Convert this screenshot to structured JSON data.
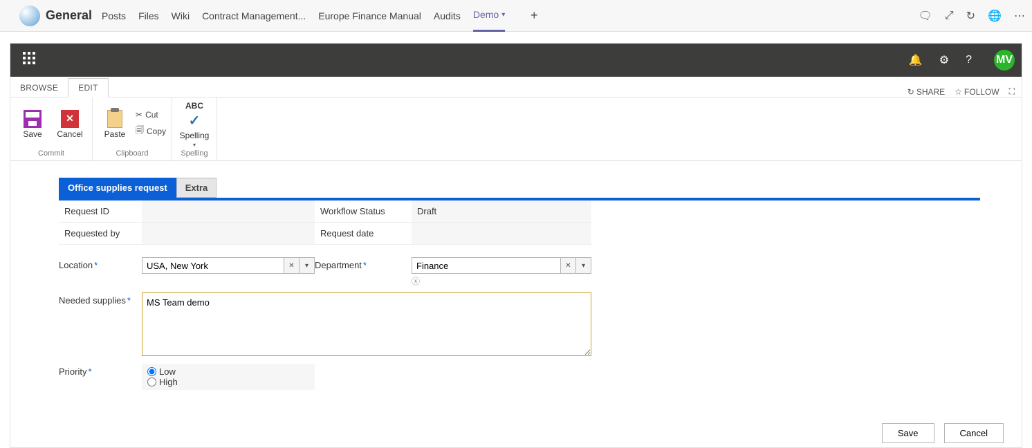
{
  "teams": {
    "channel_name": "General",
    "tabs": [
      "Posts",
      "Files",
      "Wiki",
      "Contract Management...",
      "Europe Finance Manual",
      "Audits",
      "Demo"
    ]
  },
  "suite": {
    "avatar_initials": "MV"
  },
  "sp_tabs": {
    "browse": "BROWSE",
    "edit": "EDIT",
    "share": "SHARE",
    "follow": "FOLLOW"
  },
  "ribbon": {
    "save": "Save",
    "cancel": "Cancel",
    "paste": "Paste",
    "cut": "Cut",
    "copy": "Copy",
    "spelling": "Spelling",
    "group_commit": "Commit",
    "group_clipboard": "Clipboard",
    "group_spelling": "Spelling"
  },
  "form": {
    "tab_main": "Office supplies request",
    "tab_extra": "Extra",
    "labels": {
      "request_id": "Request ID",
      "workflow_status": "Workflow Status",
      "requested_by": "Requested by",
      "request_date": "Request date",
      "location": "Location",
      "department": "Department",
      "needed_supplies": "Needed supplies",
      "priority": "Priority"
    },
    "values": {
      "request_id": "",
      "workflow_status": "Draft",
      "requested_by": "",
      "request_date": "",
      "location": "USA, New York",
      "department": "Finance",
      "needed_supplies": "MS Team demo",
      "priority_low": "Low",
      "priority_high": "High"
    },
    "buttons": {
      "save": "Save",
      "cancel": "Cancel"
    }
  }
}
